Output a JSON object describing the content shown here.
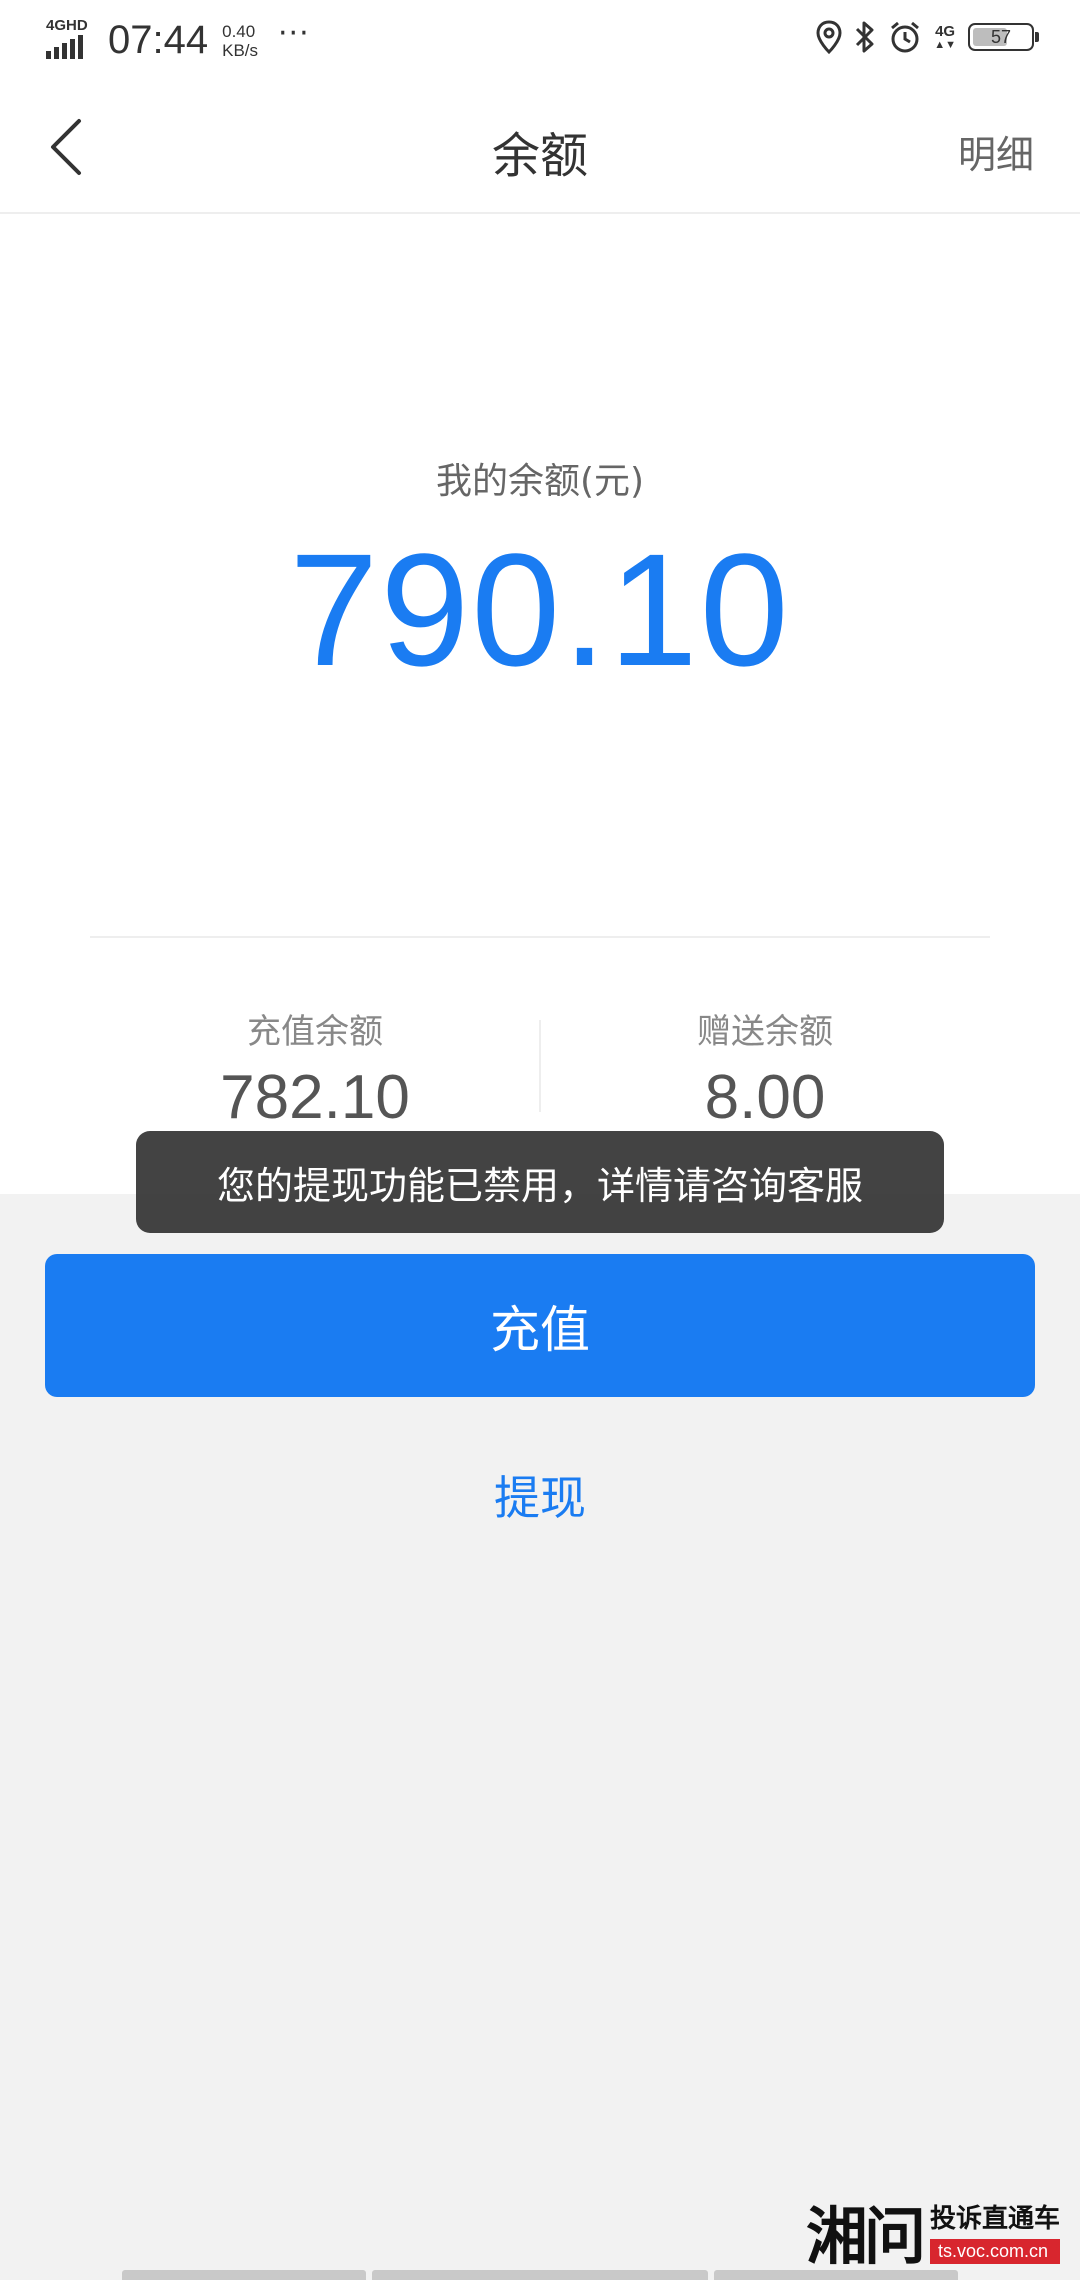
{
  "status_bar": {
    "network": "4GHD",
    "time": "07:44",
    "speed_value": "0.40",
    "speed_unit": "KB/s",
    "more": "···",
    "network_right": "4G",
    "battery": "57",
    "battery_level_percent": 57
  },
  "nav": {
    "title": "余额",
    "detail_label": "明细"
  },
  "balance": {
    "label": "我的余额(元)",
    "value": "790.10",
    "recharge_label": "充值余额",
    "recharge_value": "782.10",
    "gift_label": "赠送余额",
    "gift_value": "8.00"
  },
  "toast": {
    "message": "您的提现功能已禁用，详情请咨询客服"
  },
  "actions": {
    "recharge_button": "充值",
    "withdraw_link": "提现"
  },
  "watermark": {
    "logo": "湘问",
    "text": "投诉直通车",
    "url": "ts.voc.com.cn"
  },
  "colors": {
    "accent": "#1a7cf2",
    "background": "#f2f2f2",
    "toast_bg": "#333333",
    "watermark_red": "#d8262e"
  }
}
